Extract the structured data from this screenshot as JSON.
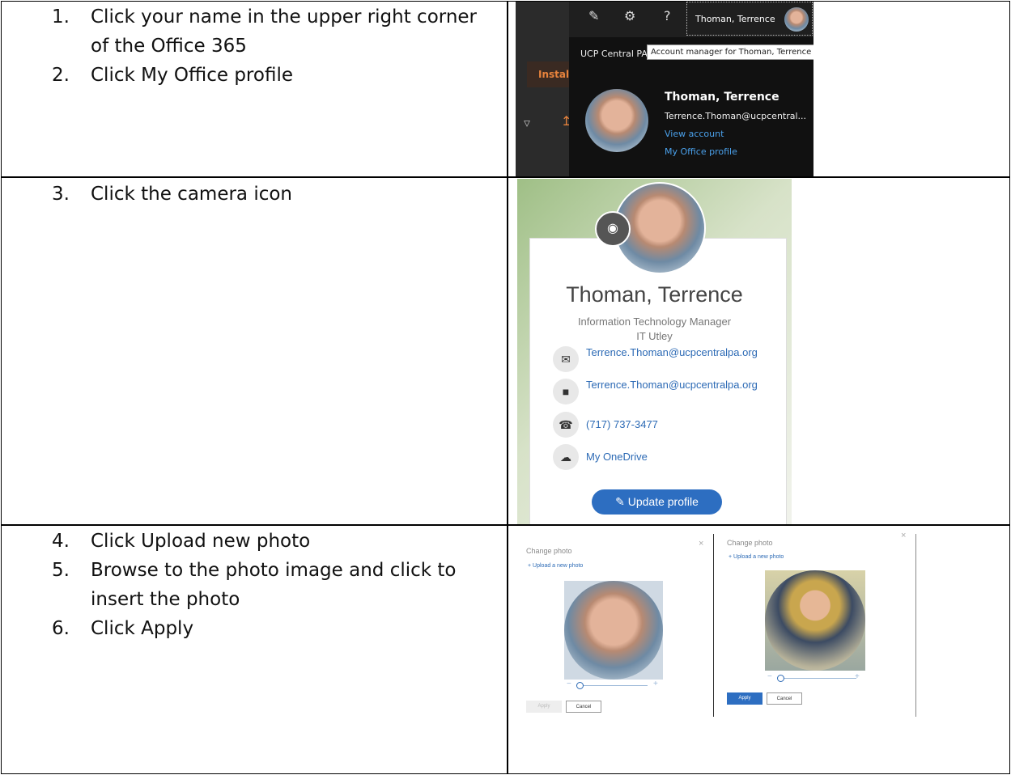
{
  "rows": [
    {
      "steps": [
        {
          "num": "1.",
          "text": "Click your name in the upper right corner of the Office 365"
        },
        {
          "num": "2.",
          "text": "Click My Office profile"
        }
      ]
    },
    {
      "steps": [
        {
          "num": "3.",
          "text": "Click the camera icon"
        }
      ]
    },
    {
      "steps": [
        {
          "num": "4.",
          "text": "Click Upload new photo"
        },
        {
          "num": "5.",
          "text": "Browse to the photo image and click to insert the photo"
        },
        {
          "num": "6.",
          "text": "Click Apply"
        }
      ]
    }
  ],
  "panel1": {
    "top_user": "Thoman, Terrence",
    "org": "UCP Central PA",
    "tooltip": "Account manager for Thoman, Terrence",
    "install": "Install",
    "name": "Thoman, Terrence",
    "email": "Terrence.Thoman@ucpcentral...",
    "view_account": "View account",
    "my_office_profile": "My Office profile",
    "icons": [
      "feedback-icon",
      "gear-icon",
      "help-icon",
      "filter-icon",
      "upload-icon"
    ]
  },
  "panel2": {
    "name": "Thoman, Terrence",
    "title": "Information Technology Manager",
    "department": "IT Utley",
    "email": "Terrence.Thoman@ucpcentralpa.org",
    "chat": "Terrence.Thoman@ucpcentralpa.org",
    "phone": "(717) 737-3477",
    "onedrive": "My OneDrive",
    "update_button": "Update profile"
  },
  "panel3": {
    "left": {
      "title": "Change photo",
      "upload": "Upload a new photo",
      "apply": "Apply",
      "cancel": "Cancel",
      "close": "×"
    },
    "right": {
      "title": "Change photo",
      "upload": "Upload a new photo",
      "apply": "Apply",
      "cancel": "Cancel",
      "close": "×"
    }
  },
  "colors": {
    "accent_blue": "#2d6ec1",
    "link_blue": "#2c6ab5",
    "install_orange": "#e6823c",
    "dark_bg": "#1f1f1f"
  }
}
